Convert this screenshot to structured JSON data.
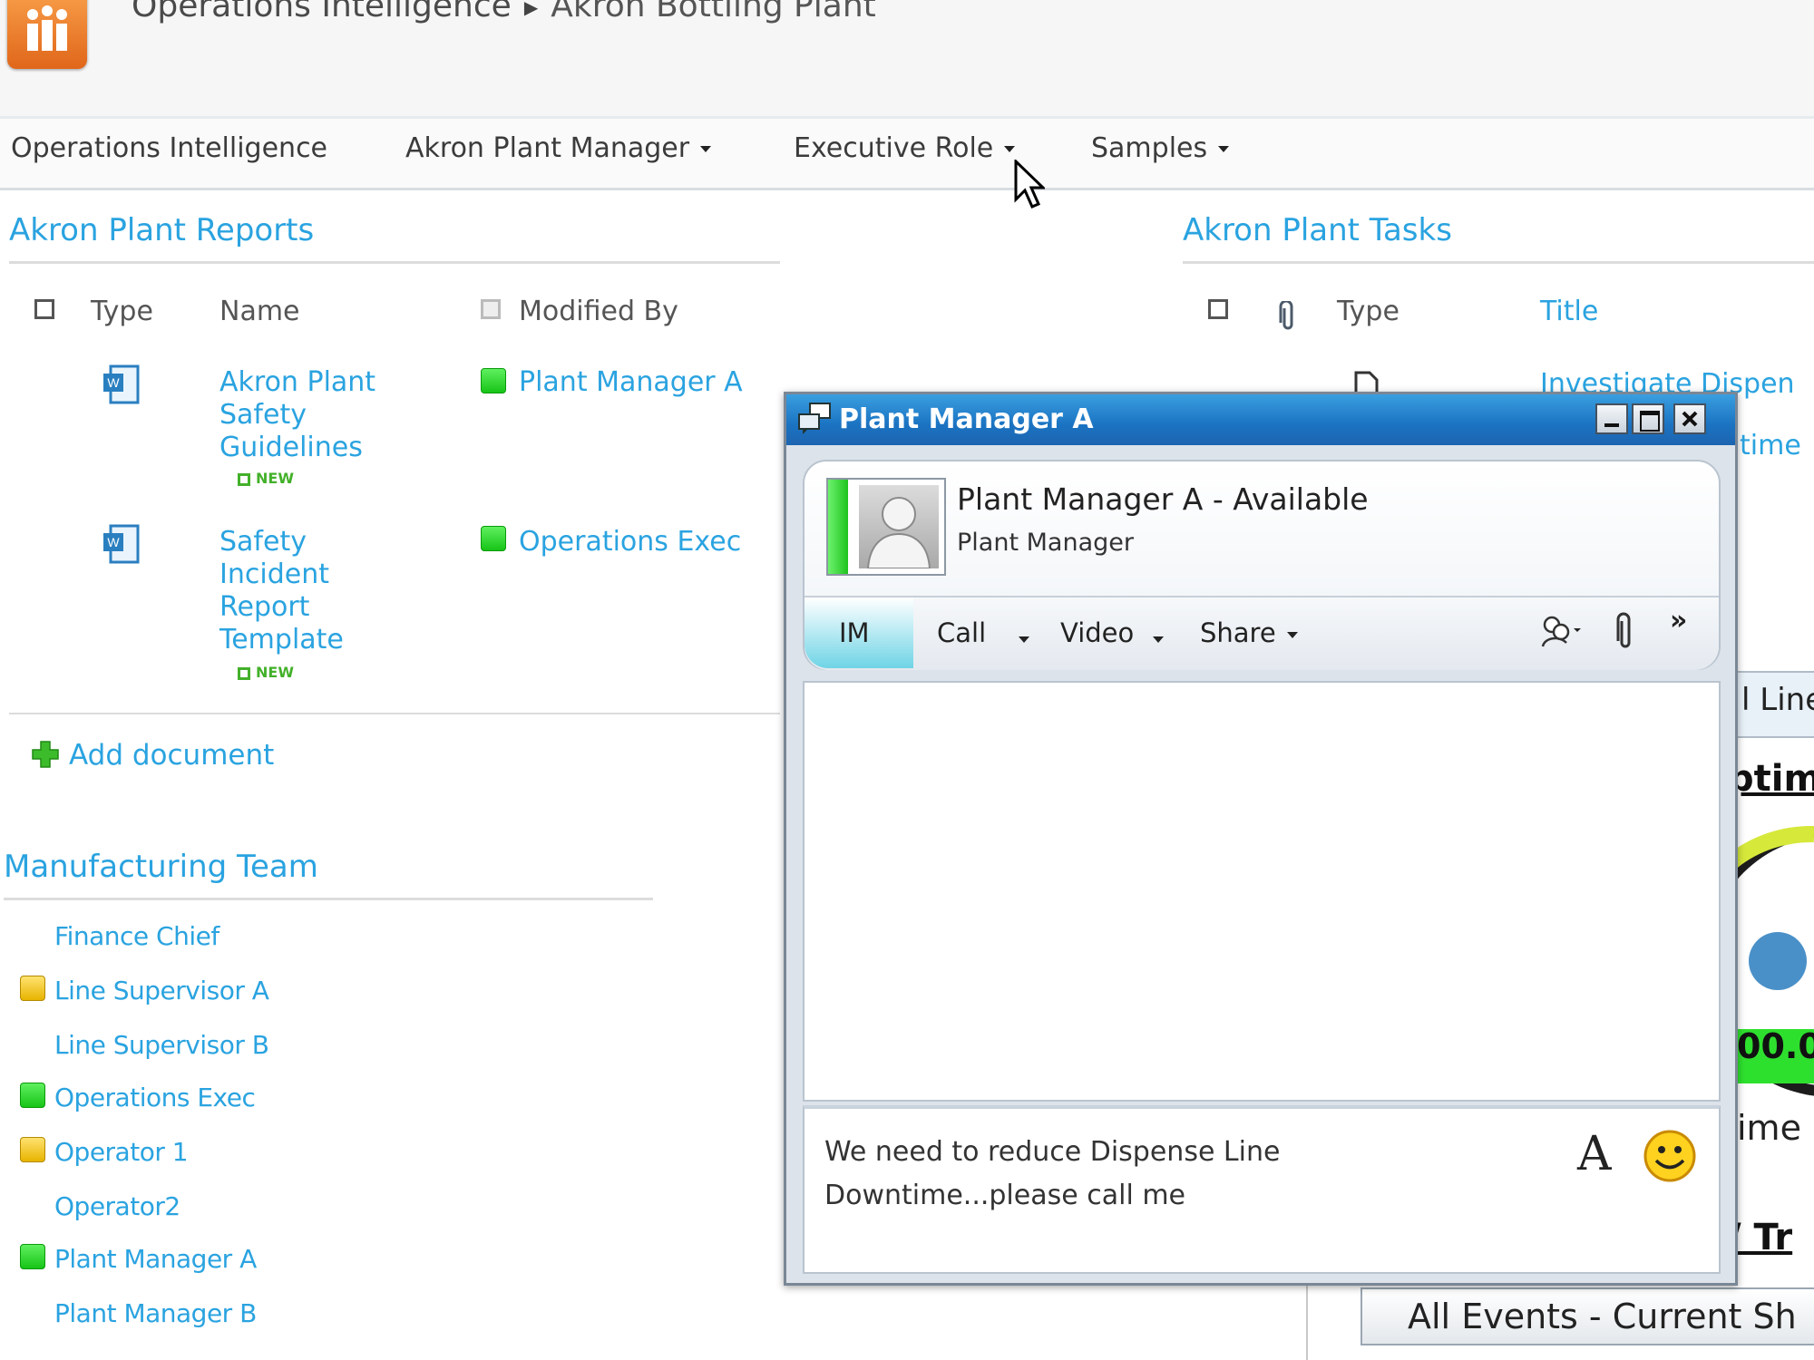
{
  "breadcrumb": {
    "site": "Operations Intelligence",
    "current": "Akron Bottling Plant"
  },
  "topnav": {
    "items": [
      {
        "label": "Operations Intelligence"
      },
      {
        "label": "Akron Plant Manager"
      },
      {
        "label": "Executive Role"
      },
      {
        "label": "Samples"
      }
    ]
  },
  "reports": {
    "title": "Akron Plant Reports",
    "columns": {
      "type": "Type",
      "name": "Name",
      "modified_by": "Modified By"
    },
    "rows": [
      {
        "name": "Akron Plant Safety Guidelines",
        "badge": "NEW",
        "modified_by": "Plant Manager A"
      },
      {
        "name": "Safety Incident Report Template",
        "badge": "NEW",
        "modified_by": "Operations Exec"
      }
    ],
    "add_label": "Add document"
  },
  "tasks": {
    "title": "Akron Plant Tasks",
    "columns": {
      "type": "Type",
      "title": "Title"
    },
    "rows": [
      {
        "title": "Investigate Dispen"
      },
      {
        "title": "time"
      }
    ]
  },
  "team": {
    "title": "Manufacturing Team",
    "members": [
      {
        "name": "Finance Chief",
        "presence": "none"
      },
      {
        "name": "Line Supervisor A",
        "presence": "away"
      },
      {
        "name": "Line Supervisor B",
        "presence": "none"
      },
      {
        "name": "Operations Exec",
        "presence": "available"
      },
      {
        "name": "Operator 1",
        "presence": "away"
      },
      {
        "name": "Operator2",
        "presence": "none"
      },
      {
        "name": "Plant Manager A",
        "presence": "available"
      },
      {
        "name": "Plant Manager B",
        "presence": "none"
      }
    ]
  },
  "chat": {
    "window_title": "Plant Manager A",
    "contact_status": "Plant Manager A - Available",
    "contact_role": "Plant Manager",
    "actions": {
      "im": "IM",
      "call": "Call",
      "video": "Video",
      "share": "Share",
      "more": "»"
    },
    "message_draft": "We need to reduce Dispense Line Downtime...please call me",
    "font_glyph": "A"
  },
  "right_fragments": {
    "line": "l Line",
    "uptime": "ptim",
    "value": "00.0",
    "time": "ime",
    "trend": "/ Tr",
    "events": "All Events - Current Sh"
  },
  "colors": {
    "accent": "#2aa3e0",
    "available": "#1ec31e",
    "away": "#e7b400",
    "titlebar": "#1b73c2"
  }
}
